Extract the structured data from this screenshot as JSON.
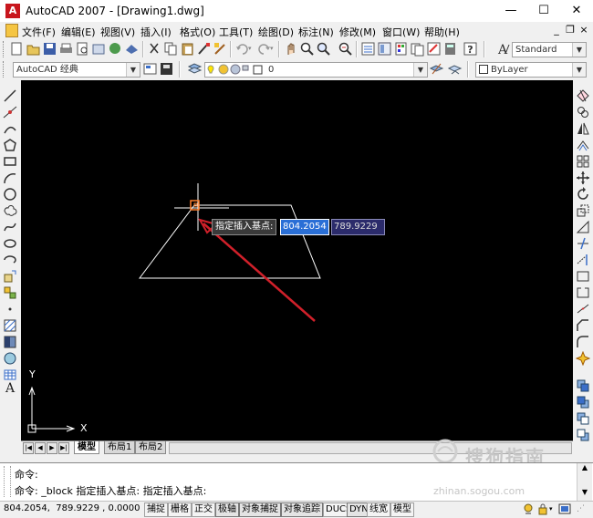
{
  "window": {
    "title": "AutoCAD 2007 - [Drawing1.dwg]",
    "app_icon": "A",
    "minimize": "—",
    "maximize": "☐",
    "close": "✕",
    "doc_minimize": "_",
    "doc_restore": "❐",
    "doc_close": "×"
  },
  "menu": [
    "文件(F)",
    "编辑(E)",
    "视图(V)",
    "插入(I)",
    "格式(O)",
    "工具(T)",
    "绘图(D)",
    "标注(N)",
    "修改(M)",
    "窗口(W)",
    "帮助(H)"
  ],
  "styles_toolbar": {
    "text_style": "Standard"
  },
  "workspace_toolbar": {
    "workspace": "AutoCAD 经典",
    "layer": "0",
    "color": "ByLayer"
  },
  "dynamic_input": {
    "prompt": "指定插入基点:",
    "x_value": "804.2054",
    "y_value": "789.9229"
  },
  "ucs": {
    "x_label": "X",
    "y_label": "Y"
  },
  "layout_tabs": [
    "模型",
    "布局1",
    "布局2"
  ],
  "command_lines": [
    "命令:",
    "命令: _block 指定插入基点: 指定插入基点:"
  ],
  "status": {
    "coordinates": "804.2054,  789.9229 , 0.0000",
    "toggles": [
      "捕捉",
      "栅格",
      "正交",
      "极轴",
      "对象捕捉",
      "对象追踪",
      "DUCS",
      "DYN",
      "线宽",
      "模型"
    ]
  },
  "watermark": {
    "text": "搜狗指南",
    "sub": "zhinan.sogou.com"
  },
  "colors": {
    "canvas": "#000000",
    "annotation_arrow": "#d0202a",
    "dyn_field_selected": "#2a6fd6",
    "dyn_field": "#2b2b6b"
  }
}
